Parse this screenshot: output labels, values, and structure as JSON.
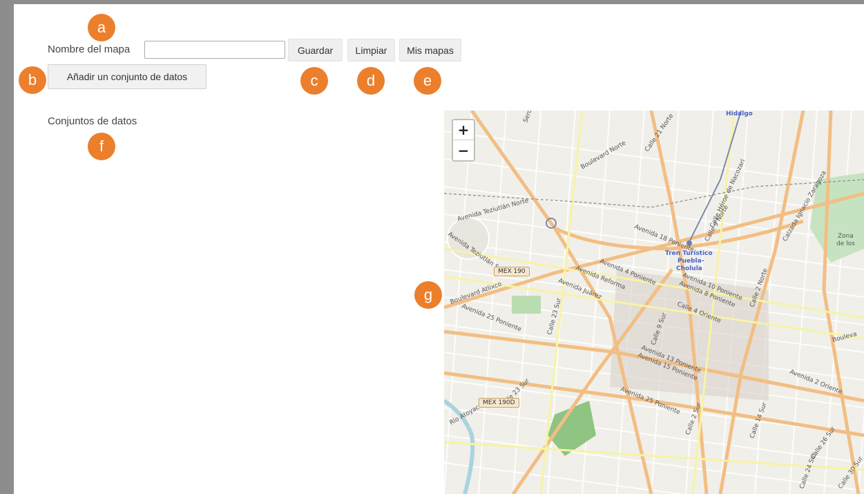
{
  "form": {
    "map_name_label": "Nombre del mapa",
    "map_name_value": "",
    "save_label": "Guardar",
    "clear_label": "Limpiar",
    "my_maps_label": "Mis mapas",
    "add_dataset_label": "Añadir un conjunto de datos",
    "datasets_label": "Conjuntos de datos"
  },
  "badges": [
    "a",
    "b",
    "c",
    "d",
    "e",
    "f",
    "g"
  ],
  "map": {
    "zoom_in": "+",
    "zoom_out": "−",
    "labels": {
      "hidalgo": "Hidalgo",
      "tren1": "Tren Turístico",
      "tren2": "Puebla-",
      "tren3": "Cholula",
      "zona1": "Zona",
      "zona2": "de los",
      "mex190": "MEX 190",
      "mex190d": "MEX 190D",
      "calle21": "Calle 21 Norte",
      "blvdnorte": "Boulevard Norte",
      "blvdatlixco": "Boulevard Atlixco",
      "blvd": "Bouleva",
      "tezi1": "Avenida Teziutlán Norte",
      "tezi2": "Avenida Teziutlán Sur",
      "av18": "Avenida 18 Poniente",
      "av4": "Avenida 4 Poniente",
      "reforma": "Avenida Reforma",
      "juarez": "Avenida Juárez",
      "av25a": "Avenida 25 Poniente",
      "av25b": "Avenida 25 Poniente",
      "av10": "Avenida 10 Poniente",
      "av8": "Avenida 8 Poniente",
      "calle4": "Calle 4 Oriente",
      "calle9": "Calle 9 Sur",
      "av13": "Avenida 13 Poniente",
      "av15": "Avenida 15 Poniente",
      "calle23a": "Calle 23 Sur",
      "calle23b": "Calle 23 Sur",
      "calle2": "Calle 2 Norte",
      "calle14": "Calle 14 Sur",
      "av2": "Avenida 2 Oriente",
      "calle26": "Calle 26 Sur",
      "calle24": "Calle 24 Sur",
      "calle30": "Calle 30 Sur",
      "calle2s": "Calle 2 Sur",
      "zaragoza": "Calzada Ignacio Zaragoza",
      "heroe": "Calle Héroe de Nacozari",
      "calle9n": "Calle 9 Norte",
      "rio": "Río Atoyac",
      "serdan": "Serdán"
    }
  }
}
